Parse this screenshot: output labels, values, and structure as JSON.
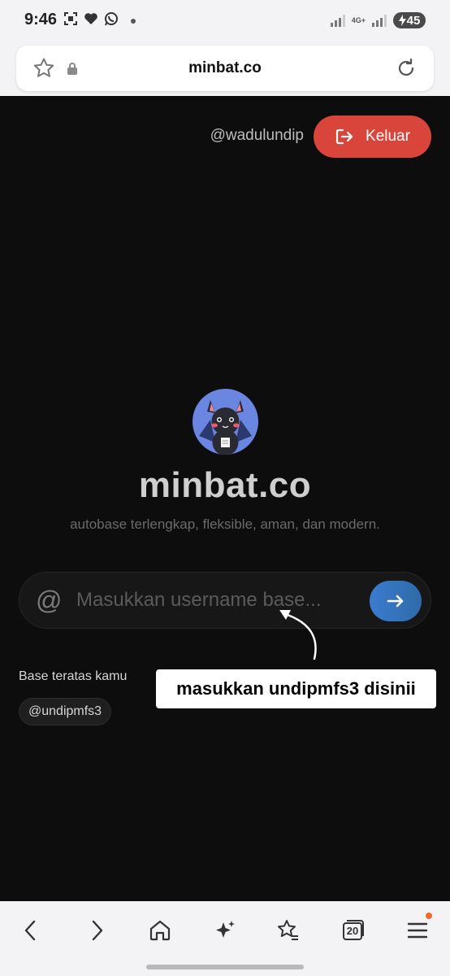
{
  "status_bar": {
    "time": "9:46",
    "network": "4G+",
    "battery": "45",
    "icons": [
      "screenshot-icon",
      "heart-icon",
      "whatsapp-icon",
      "dot-icon",
      "signal-icon",
      "battery-charging-icon"
    ]
  },
  "browser": {
    "url": "minbat.co",
    "icons": [
      "bookmark-star-icon",
      "lock-icon",
      "reload-icon"
    ]
  },
  "header": {
    "username": "@wadulundip",
    "logout_label": "Keluar",
    "logout_color": "#d9453b"
  },
  "hero": {
    "title": "minbat.co",
    "tagline": "autobase terlengkap, fleksible, aman, dan modern."
  },
  "search": {
    "prefix": "@",
    "placeholder": "Masukkan username base...",
    "value": "",
    "submit_icon": "arrow-right-icon",
    "accent_color": "#3b7bd0"
  },
  "annotation": {
    "text": "masukkan undipmfs3 disinii"
  },
  "top_bases": {
    "label": "Base teratas kamu",
    "items": [
      "@undipmfs3"
    ]
  },
  "bottom_nav": {
    "tab_count": "20",
    "items": [
      "back-icon",
      "forward-icon",
      "home-icon",
      "sparkle-icon",
      "favorites-icon",
      "tabs-icon",
      "menu-icon"
    ]
  }
}
